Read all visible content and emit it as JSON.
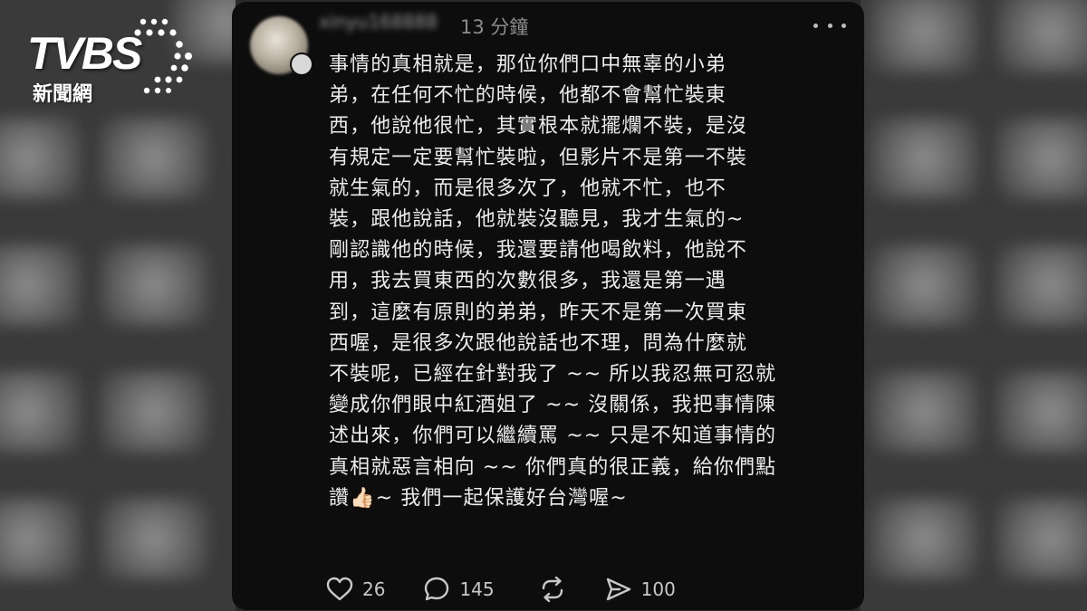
{
  "logo": {
    "brand": "TVBS",
    "subtitle": "新聞網"
  },
  "post": {
    "username": "xinyu168888",
    "timestamp": "13 分鐘",
    "more_icon": "more-horizontal-icon",
    "body": "事情的真相就是，那位你們口中無辜的小弟\n弟，在任何不忙的時候，他都不會幫忙裝東\n西，他說他很忙，其實根本就擺爛不裝，是沒\n有規定一定要幫忙裝啦，但影片不是第一不裝\n就生氣的，而是很多次了，他就不忙，也不\n裝，跟他說話，他就裝沒聽見，我才生氣的~\n剛認識他的時候，我還要請他喝飲料，他說不\n用，我去買東西的次數很多，我還是第一遇\n到，這麼有原則的弟弟，昨天不是第一次買東\n西喔，是很多次跟他說話也不理，問為什麼就\n不裝呢，已經在針對我了 ~~ 所以我忍無可忍就\n變成你們眼中紅酒姐了 ~~ 沒關係，我把事情陳\n述出來，你們可以繼續罵 ~~ 只是不知道事情的\n真相就惡言相向 ~~ 你們真的很正義，給你們點\n讚👍🏻~ 我們一起保護好台灣喔~",
    "actions": {
      "likes": "26",
      "comments": "145",
      "shares": "100"
    }
  },
  "colors": {
    "card_background": "#0d0d0d",
    "text": "#ececec",
    "muted": "#8c8c8c",
    "logo": "#ffffff"
  }
}
